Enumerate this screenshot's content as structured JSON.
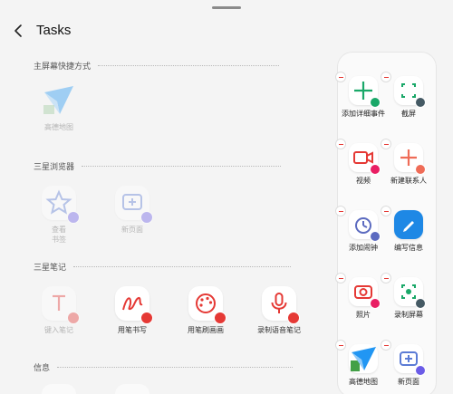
{
  "header": {
    "title": "Tasks"
  },
  "colors": {
    "red": "#e53935",
    "blue": "#1e88e5",
    "green": "#1aa869",
    "purple": "#7c6df0"
  },
  "sections": [
    {
      "title": "主屏幕快捷方式"
    },
    {
      "title": "三星浏览器"
    },
    {
      "title": "三星笔记"
    },
    {
      "title": "信息"
    }
  ],
  "tiles": {
    "amap": "高德地图",
    "bookmark": "查看\n书签",
    "new_page": "新页面",
    "type_note": "键入笔记",
    "pen_write": "用笔书写",
    "pen_draw": "用笔刷画画",
    "voice_note": "录制语音笔记"
  },
  "panel": {
    "items": [
      "添加详细事件",
      "截屏",
      "视频",
      "新建联系人",
      "添加闹钟",
      "编写信息",
      "照片",
      "录制屏幕",
      "高德地图",
      "新页面"
    ]
  }
}
